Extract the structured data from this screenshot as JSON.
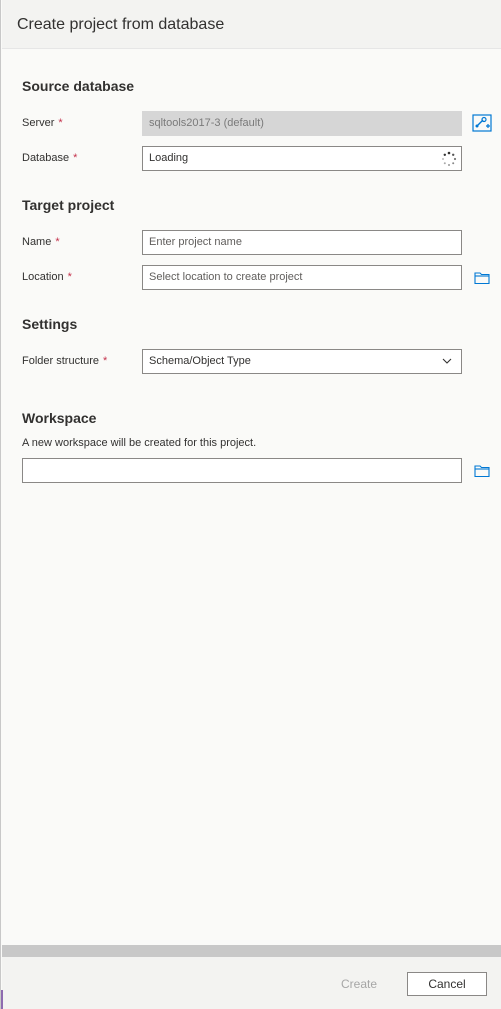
{
  "dialog": {
    "title": "Create project from database"
  },
  "source": {
    "heading": "Source database",
    "server_label": "Server",
    "server_value": "sqltools2017-3 (default)",
    "database_label": "Database",
    "database_value": "Loading"
  },
  "target": {
    "heading": "Target project",
    "name_label": "Name",
    "name_placeholder": "Enter project name",
    "location_label": "Location",
    "location_placeholder": "Select location to create project"
  },
  "settings": {
    "heading": "Settings",
    "folder_label": "Folder structure",
    "folder_value": "Schema/Object Type"
  },
  "workspace": {
    "heading": "Workspace",
    "helper": "A new workspace will be created for this project.",
    "value": ""
  },
  "required_marker": "*",
  "footer": {
    "create_label": "Create",
    "cancel_label": "Cancel"
  },
  "icons": {
    "connect": "connect-server-icon",
    "spinner": "loading-spinner-icon",
    "folder": "folder-icon",
    "chevron": "chevron-down-icon"
  },
  "colors": {
    "accent": "#0078d4",
    "required": "#c4314b"
  }
}
